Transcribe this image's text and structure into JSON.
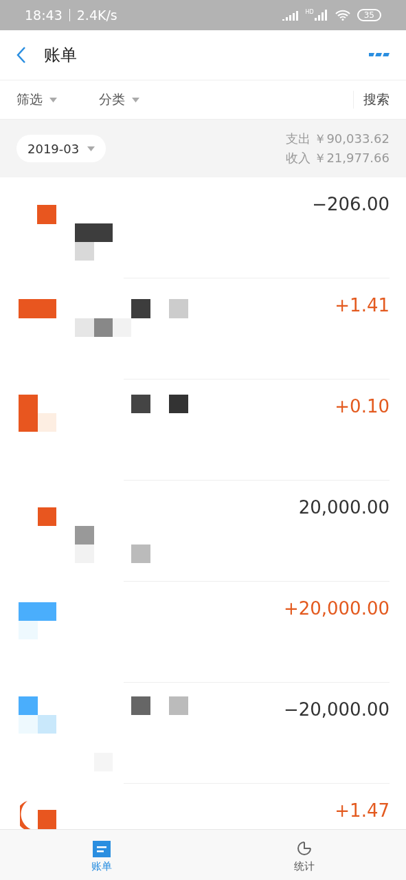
{
  "status_bar": {
    "time": "18:43",
    "speed": "2.4K/s",
    "network": "HD",
    "battery": "35"
  },
  "header": {
    "title": "账单"
  },
  "filters": [
    {
      "label": "筛选",
      "kind": "dropdown"
    },
    {
      "label": "分类",
      "kind": "dropdown"
    },
    {
      "label": "搜索",
      "kind": "action"
    }
  ],
  "summary": {
    "month": "2019-03",
    "expense_label": "支出",
    "expense": "￥90,033.62",
    "income_label": "收入",
    "income": "￥21,977.66"
  },
  "bills": [
    {
      "amount": "−206.00",
      "kind": "plain"
    },
    {
      "amount": "+1.41",
      "kind": "income"
    },
    {
      "amount": "+0.10",
      "kind": "income"
    },
    {
      "amount": "20,000.00",
      "kind": "plain"
    },
    {
      "amount": "+20,000.00",
      "kind": "income"
    },
    {
      "amount": "−20,000.00",
      "kind": "plain"
    },
    {
      "amount": "+1.47",
      "kind": "income"
    }
  ],
  "nav": [
    {
      "label": "账单",
      "selected": true
    },
    {
      "label": "统计",
      "selected": false
    }
  ]
}
